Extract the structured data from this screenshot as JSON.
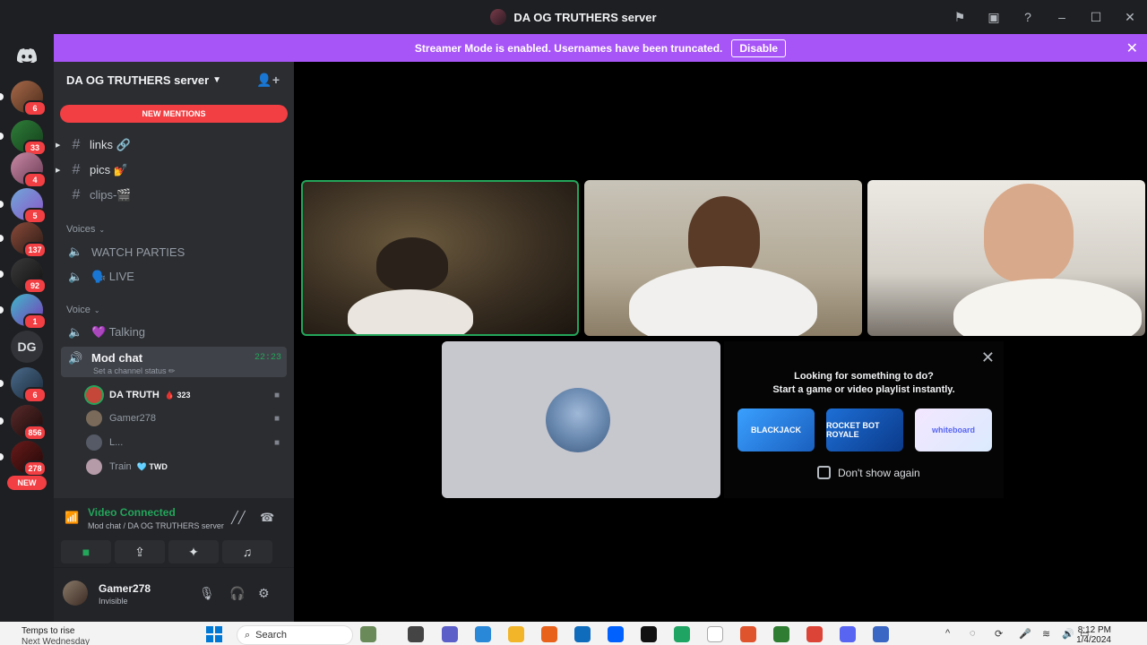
{
  "window": {
    "title": "DA OG TRUTHERS server"
  },
  "banner": {
    "message": "Streamer Mode is enabled. Usernames have been truncated.",
    "button": "Disable"
  },
  "rail": {
    "badges": [
      "6",
      "33",
      "4",
      "5",
      "137",
      "92",
      "1",
      "6",
      "856",
      "278"
    ],
    "dg_label": "DG",
    "new_label": "NEW"
  },
  "sidebar": {
    "server_name": "DA OG TRUTHERS server",
    "new_mentions": "NEW MENTIONS",
    "text_channels": [
      {
        "label": "links 🔗"
      },
      {
        "label": "pics 💅"
      },
      {
        "label": "clips-🎬"
      }
    ],
    "categories": {
      "voices": "Voices",
      "voice": "Voice"
    },
    "voices_channels": [
      {
        "label": "WATCH PARTIES"
      },
      {
        "label": "🗣️ LIVE"
      }
    ],
    "voice_channels": [
      {
        "label": "💜 Talking"
      }
    ],
    "active_channel": {
      "label": "Mod chat",
      "timer": "22:23",
      "status": "Set a channel status ✏"
    },
    "members": [
      {
        "name": "DA TRUTH",
        "extra": "🩸 323",
        "bold": true,
        "speaking": true
      },
      {
        "name": "Gamer278",
        "extra": "",
        "bold": false,
        "speaking": false
      },
      {
        "name": "L...",
        "extra": "",
        "bold": false,
        "speaking": false
      },
      {
        "name": "Train",
        "extra": "🩵 TWD",
        "bold": false,
        "speaking": false
      }
    ]
  },
  "voice_panel": {
    "status": "Video Connected",
    "location": "Mod chat / DA OG TRUTHERS server"
  },
  "user_panel": {
    "name": "Gamer278",
    "status": "Invisible"
  },
  "activity": {
    "line1": "Looking for something to do?",
    "line2": "Start a game or video playlist instantly.",
    "tiles": [
      "BLACKJACK",
      "ROCKET BOT ROYALE",
      "whiteboard"
    ],
    "checkbox_label": "Don't show again"
  },
  "taskbar": {
    "weather_line1": "Temps to rise",
    "weather_line2": "Next Wednesday",
    "search_placeholder": "Search",
    "time": "8:12 PM",
    "date": "1/4/2024"
  },
  "colors": {
    "accent": "#a855f7",
    "online": "#23a55a",
    "danger": "#f23f43"
  }
}
